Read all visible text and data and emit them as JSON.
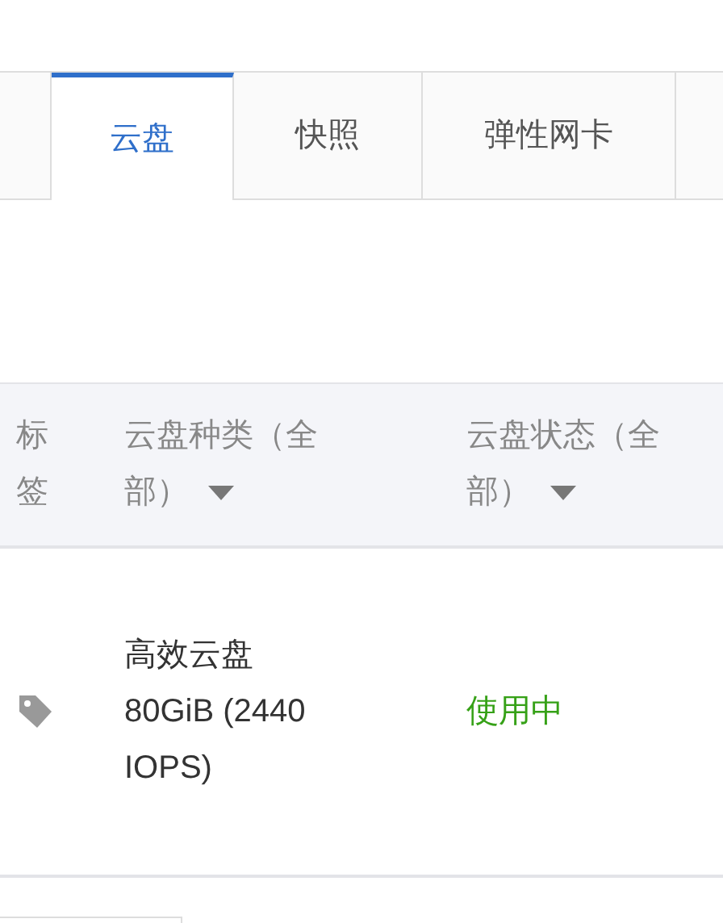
{
  "tabs": [
    {
      "label": "云盘",
      "selected": true
    },
    {
      "label": "快照",
      "selected": false
    },
    {
      "label": "弹性网卡",
      "selected": false
    }
  ],
  "table": {
    "columns": [
      {
        "label": "标签"
      },
      {
        "label": "云盘种类（全部）",
        "filter": true
      },
      {
        "label": "云盘状态（全部）",
        "filter": true
      }
    ],
    "rows": [
      {
        "tag": true,
        "disk_type": "高效云盘 80GiB (2440 IOPS)",
        "status": "使用中",
        "color": "#36a117"
      }
    ]
  }
}
